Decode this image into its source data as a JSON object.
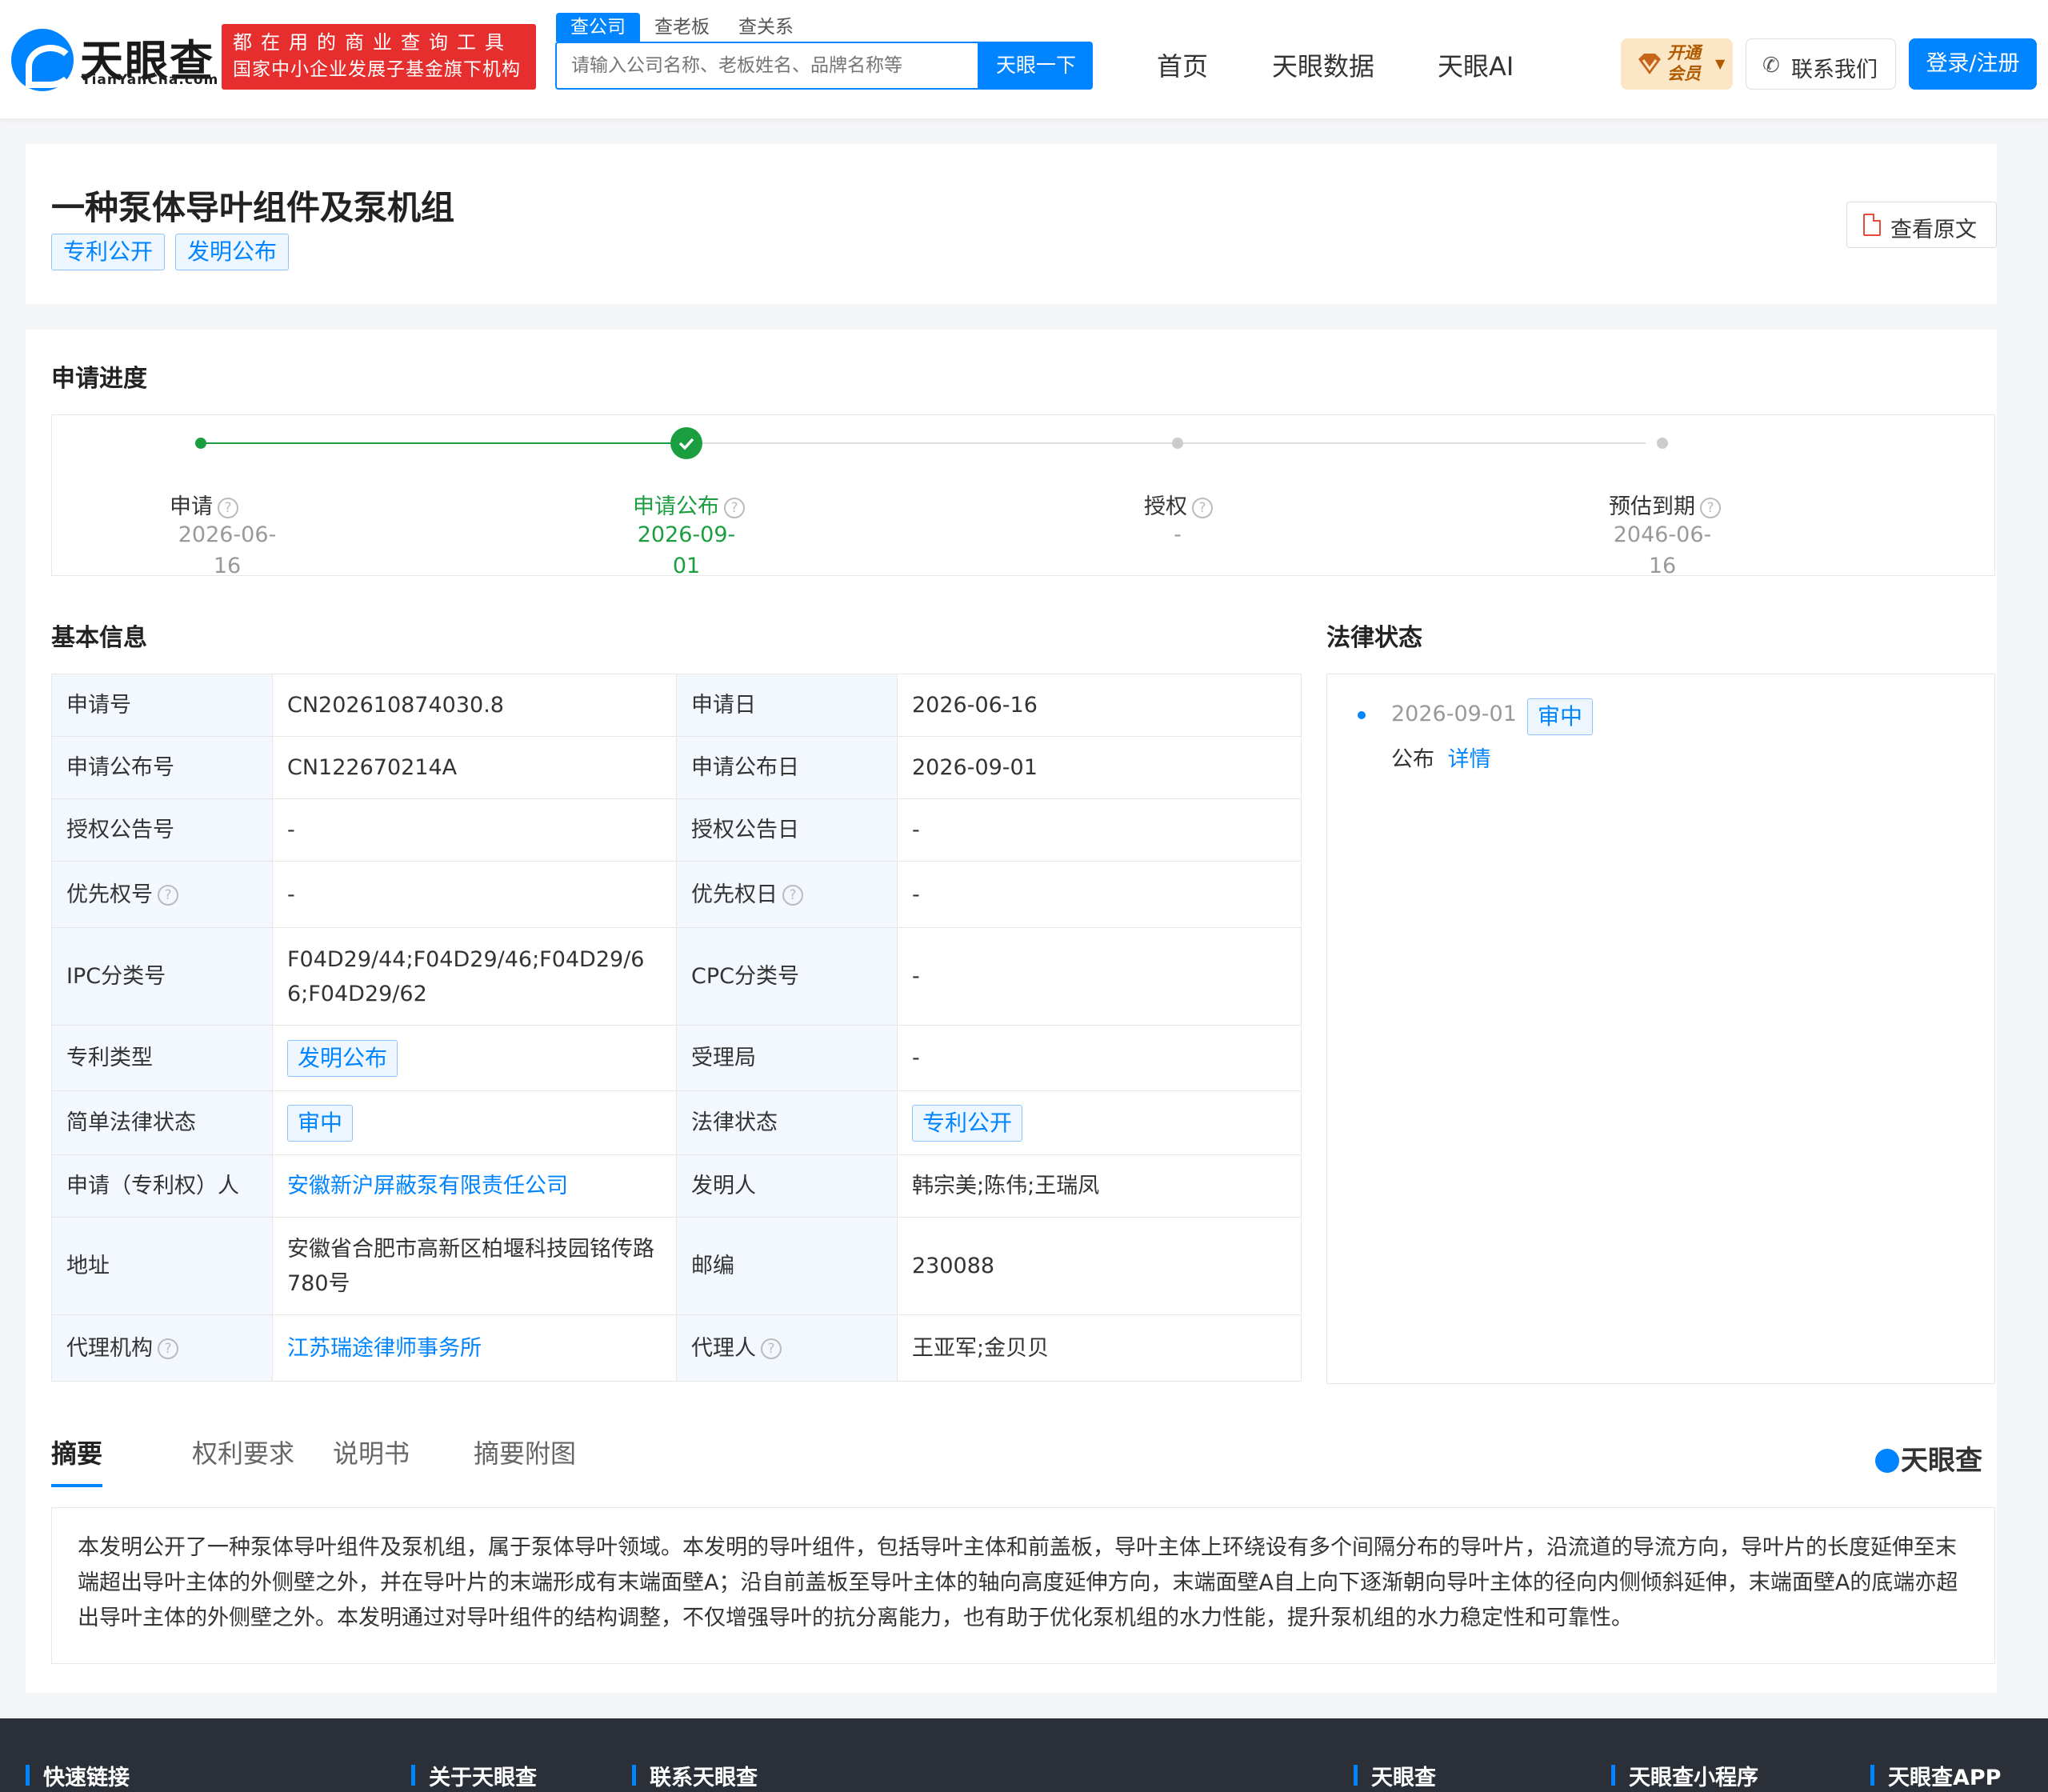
{
  "header": {
    "logo_text": "天眼查",
    "logo_sub": "TianYanCha.com",
    "slogan_line1": "都在用的商业查询工具",
    "slogan_line2": "国家中小企业发展子基金旗下机构",
    "search_tabs": [
      "查公司",
      "查老板",
      "查关系"
    ],
    "search_placeholder": "请输入公司名称、老板姓名、品牌名称等",
    "search_button": "天眼一下",
    "nav": [
      "首页",
      "天眼数据",
      "天眼AI"
    ],
    "vip_line1": "开通",
    "vip_line2": "会员",
    "contact_label": "联系我们",
    "login_label": "登录/注册"
  },
  "patent": {
    "title": "一种泵体导叶组件及泵机组",
    "tags": [
      "专利公开",
      "发明公布"
    ],
    "view_original": "查看原文"
  },
  "progress": {
    "section_title": "申请进度",
    "steps": [
      {
        "label": "申请",
        "date": "2026-06-16"
      },
      {
        "label": "申请公布",
        "date": "2026-09-01"
      },
      {
        "label": "授权",
        "date": "-"
      },
      {
        "label": "预估到期",
        "date": "2046-06-16"
      }
    ]
  },
  "basic": {
    "section_title": "基本信息",
    "rows": [
      {
        "k1": "申请号",
        "v1": "CN202610874030.8",
        "k2": "申请日",
        "v2": "2026-06-16"
      },
      {
        "k1": "申请公布号",
        "v1": "CN122670214A",
        "k2": "申请公布日",
        "v2": "2026-09-01"
      },
      {
        "k1": "授权公告号",
        "v1": "-",
        "k2": "授权公告日",
        "v2": "-"
      },
      {
        "k1": "优先权号",
        "v1": "-",
        "k2": "优先权日",
        "v2": "-"
      },
      {
        "k1": "IPC分类号",
        "v1": "F04D29/44;F04D29/46;F04D29/66;F04D29/62",
        "k2": "CPC分类号",
        "v2": "-"
      },
      {
        "k1": "专利类型",
        "v1": "发明公布",
        "k2": "受理局",
        "v2": "-"
      },
      {
        "k1": "简单法律状态",
        "v1": "审中",
        "k2": "法律状态",
        "v2": "专利公开"
      },
      {
        "k1": "申请（专利权）人",
        "v1": "安徽新沪屏蔽泵有限责任公司",
        "k2": "发明人",
        "v2": "韩宗美;陈伟;王瑞凤"
      },
      {
        "k1": "地址",
        "v1": "安徽省合肥市高新区柏堰科技园铭传路780号",
        "k2": "邮编",
        "v2": "230088"
      },
      {
        "k1": "代理机构",
        "v1": "江苏瑞途律师事务所",
        "k2": "代理人",
        "v2": "王亚军;金贝贝"
      }
    ]
  },
  "legal": {
    "section_title": "法律状态",
    "entries": [
      {
        "date": "2026-09-01",
        "status": "审中",
        "event": "公布",
        "link": "详情"
      }
    ]
  },
  "detail_tabs": [
    "摘要",
    "权利要求",
    "说明书",
    "摘要附图"
  ],
  "brand_small": "天眼查",
  "abstract": "本发明公开了一种泵体导叶组件及泵机组，属于泵体导叶领域。本发明的导叶组件，包括导叶主体和前盖板，导叶主体上环绕设有多个间隔分布的导叶片，沿流道的导流方向，导叶片的长度延伸至末端超出导叶主体的外侧壁之外，并在导叶片的末端形成有末端面壁A；沿自前盖板至导叶主体的轴向高度延伸方向，末端面壁A自上向下逐渐朝向导叶主体的径向内侧倾斜延伸，末端面壁A的底端亦超出导叶主体的外侧壁之外。本发明通过对导叶组件的结构调整，不仅增强导叶的抗分离能力，也有助于优化泵机组的水力性能，提升泵机组的水力稳定性和可靠性。",
  "footer": [
    "快速链接",
    "关于天眼查",
    "联系天眼查",
    "天眼查",
    "天眼查小程序",
    "天眼查APP"
  ]
}
